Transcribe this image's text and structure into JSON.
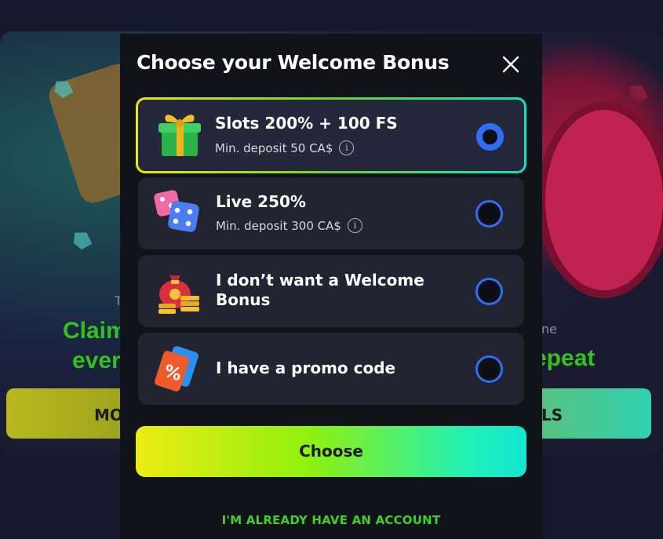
{
  "background": {
    "small_left": "T",
    "headline_left_line1": "Claim",
    "headline_left_line2": "ever",
    "small_right": "ne",
    "headline_right": "epeat",
    "button_left_label": "MO",
    "button_right_label": "LS"
  },
  "modal": {
    "title": "Choose your Welcome Bonus",
    "close_icon": "close-icon",
    "options": [
      {
        "title": "Slots 200% + 100 FS",
        "subtitle": "Min. deposit 50 CA$",
        "icon": "gift-box-icon",
        "selected": true
      },
      {
        "title": "Live 250%",
        "subtitle": "Min. deposit 300 CA$",
        "icon": "dice-icon",
        "selected": false
      },
      {
        "title_line1": "I don’t want a Welcome",
        "title_line2": "Bonus",
        "icon": "money-bag-icon",
        "selected": false
      },
      {
        "title": "I have a promo code",
        "icon": "promo-ticket-icon",
        "selected": false
      }
    ],
    "info_glyph": "i",
    "choose_label": "Choose",
    "account_link": "I'M ALREADY HAVE AN ACCOUNT"
  },
  "colors": {
    "accent_blue": "#2f6ef5",
    "accent_green": "#3fd12a",
    "modal_bg": "#111319",
    "option_bg": "#222431"
  }
}
